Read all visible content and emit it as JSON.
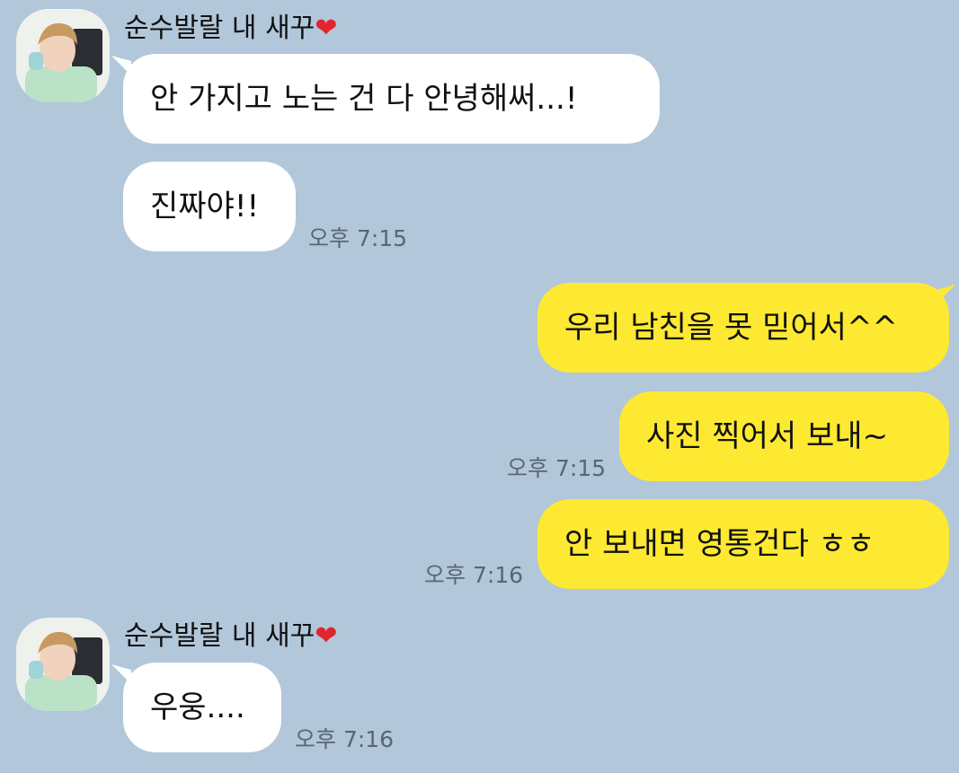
{
  "chat": {
    "sender_name": "순수발랄 내 새꾸",
    "sender_heart": "❤",
    "colors": {
      "background": "#b2c7da",
      "incoming_bubble": "#ffffff",
      "outgoing_bubble": "#fee932",
      "heart": "#e0262c",
      "timestamp": "#5a6673"
    },
    "messages": [
      {
        "side": "incoming",
        "text": "안 가지고 노는 건 다 안녕해써...!"
      },
      {
        "side": "incoming",
        "text": "진짜야!!",
        "time": "오후 7:15"
      },
      {
        "side": "outgoing",
        "text": "우리 남친을 못 믿어서^^"
      },
      {
        "side": "outgoing",
        "text": "사진 찍어서 보내~",
        "time": "오후 7:15"
      },
      {
        "side": "outgoing",
        "text": "안 보내면 영통건다 ㅎㅎ",
        "time": "오후 7:16"
      },
      {
        "side": "incoming",
        "text": "우웅....",
        "time": "오후 7:16"
      }
    ]
  }
}
